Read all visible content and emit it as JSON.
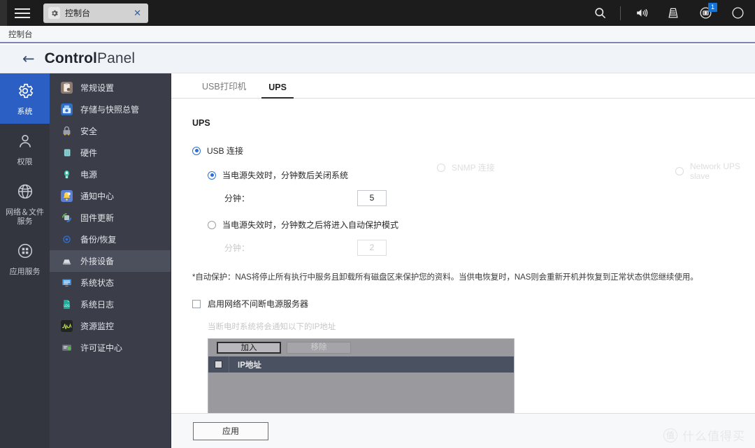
{
  "window": {
    "tab": {
      "label": "控制台",
      "icon": "gear-icon",
      "close_icon": "✕"
    },
    "breadcrumb": "控制台",
    "topbar_icons": [
      "search-icon",
      "volume-icon",
      "monitor-icon",
      "notification-icon",
      "user-icon"
    ],
    "notification_badge": "1"
  },
  "header": {
    "back_icon": "←",
    "title_bold": "Control",
    "title_light": "Panel"
  },
  "rail": {
    "items": [
      {
        "label": "系统",
        "icon": "gear-icon",
        "active": true
      },
      {
        "label": "权限",
        "icon": "user-icon",
        "active": false
      },
      {
        "label": "网络＆文件\n服务",
        "icon": "globe-icon",
        "active": false
      },
      {
        "label": "应用服务",
        "icon": "grid-icon",
        "active": false
      }
    ]
  },
  "submenu": {
    "items": [
      {
        "label": "常规设置",
        "icon": "clipboard-icon",
        "color": "#8d7a6a",
        "selected": false
      },
      {
        "label": "存储与快照总管",
        "icon": "storage-icon",
        "color": "#2c6fc6",
        "selected": false
      },
      {
        "label": "安全",
        "icon": "lock-icon",
        "color": "#9aa0a8",
        "selected": false
      },
      {
        "label": "硬件",
        "icon": "hardware-icon",
        "color": "#58a6a6",
        "selected": false
      },
      {
        "label": "电源",
        "icon": "power-bulb-icon",
        "color": "#3bbfae",
        "selected": false
      },
      {
        "label": "通知中心",
        "icon": "bell-icon",
        "color": "#5b7fd4",
        "selected": false
      },
      {
        "label": "固件更新",
        "icon": "firmware-update-icon",
        "color": "#59b84a",
        "selected": false
      },
      {
        "label": "备份/恢复",
        "icon": "backup-restore-icon",
        "color": "#2f6fd0",
        "selected": false
      },
      {
        "label": "外接设备",
        "icon": "external-device-icon",
        "color": "#cfd3d8",
        "selected": true
      },
      {
        "label": "系统状态",
        "icon": "system-status-icon",
        "color": "#3b8fe0",
        "selected": false
      },
      {
        "label": "系统日志",
        "icon": "system-log-icon",
        "color": "#1fae9e",
        "selected": false
      },
      {
        "label": "资源监控",
        "icon": "resource-monitor-icon",
        "color": "#2a2a2a",
        "selected": false
      },
      {
        "label": "许可证中心",
        "icon": "license-center-icon",
        "color": "#6f7780",
        "selected": false
      }
    ]
  },
  "content": {
    "tabs": [
      {
        "label": "USB打印机",
        "active": false
      },
      {
        "label": "UPS",
        "active": true
      }
    ],
    "section_title": "UPS",
    "connections": [
      {
        "label": "USB 连接",
        "checked": true,
        "enabled": true
      },
      {
        "label": "SNMP 连接",
        "checked": false,
        "enabled": false
      },
      {
        "label": "Network UPS slave",
        "checked": false,
        "enabled": false
      }
    ],
    "options": [
      {
        "label": "当电源失效时，分钟数后关闭系统",
        "checked": true,
        "enabled": true,
        "minutes_label": "分钟：",
        "minutes_value": "5"
      },
      {
        "label": "当电源失效时，分钟数之后将进入自动保护模式",
        "checked": false,
        "enabled": true,
        "minutes_label": "分钟：",
        "minutes_value": "2"
      }
    ],
    "note": "*自动保护：NAS将停止所有执行中服务且卸载所有磁盘区来保护您的资料。当供电恢复时，NAS则会重新开机并恢复到正常状态供您继续使用。",
    "network_ups": {
      "checkbox_label": "启用网络不间断电源服务器",
      "checked": false,
      "hint": "当断电时系统将会通知以下的IP地址"
    },
    "ip_table": {
      "add_button": "加入",
      "remove_button": "移除",
      "column_header": "IP地址",
      "rows": []
    }
  },
  "footer": {
    "apply_button": "应用"
  },
  "watermark": {
    "mark": "值",
    "text": "什么值得买"
  }
}
